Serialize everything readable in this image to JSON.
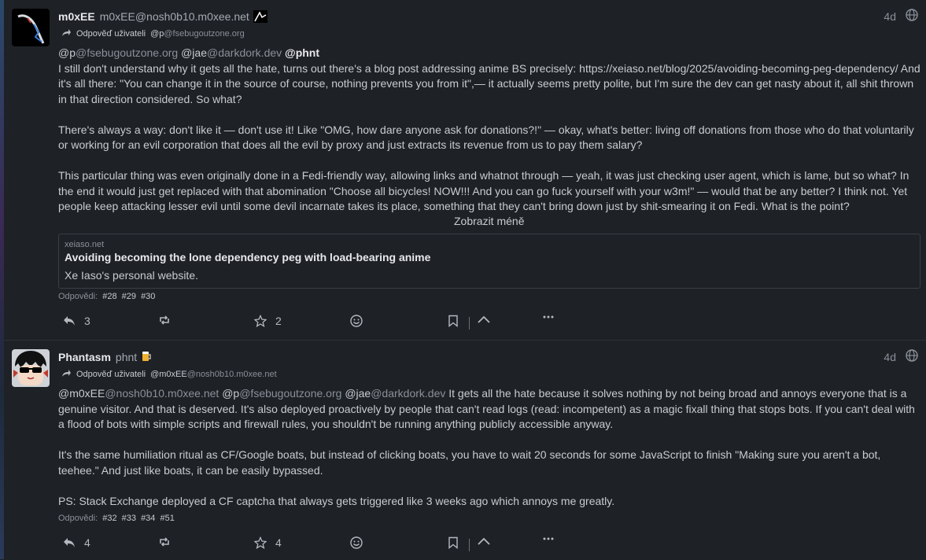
{
  "posts": [
    {
      "name": "m0xEE",
      "handle": "m0xEE@nosh0b10.m0xee.net",
      "time": "4d",
      "reply_label": "Odpověď uživateli",
      "reply_to_user": "@p",
      "reply_to_domain": "@fsebugoutzone.org",
      "mentions": [
        {
          "user": "@p",
          "domain": "@fsebugoutzone.org"
        },
        {
          "user": "@jae",
          "domain": "@darkdork.dev"
        }
      ],
      "mention_bold": "@phnt",
      "paragraphs": [
        "I still don't understand why it gets all the hate, turns out there's a blog post addressing anime BS precisely: https://xeiaso.net/blog/2025/avoiding-becoming-peg-dependency/ And it's all there: \"You can change it in the source of course, nothing prevents you from it\",— it actually seems pretty polite, but I'm sure the dev can get nasty about it, all shit thrown in that direction considered. So what?",
        "There's always a way: don't like it — don't use it! Like \"OMG, how dare anyone ask for donations?!\" — okay, what's better: living off donations from those who do that voluntarily or working for an evil corporation that does all the evil by proxy and just extracts its revenue from us to pay them salary?",
        "This particular thing was even originally done in a Fedi-friendly way, allowing links and whatnot through — yeah, it was just checking user agent, which is lame, but so what? In the end it would just get replaced with that abomination \"Choose all bicycles! NOW!!! And you can go fuck yourself with your w3m!\" — would that be any better? I think not. Yet people keep attacking lesser evil until some devil incarnate takes its place, something that they can't bring down just by shit-smearing it on Fedi. What is the point?"
      ],
      "show_less": "Zobrazit méně",
      "card": {
        "host": "xeiaso.net",
        "title": "Avoiding becoming the lone dependency peg with load-bearing anime",
        "description": "Xe Iaso's personal website."
      },
      "replies_label": "Odpovědi:",
      "replies": [
        "#28",
        "#29",
        "#30"
      ],
      "reply_count": "3",
      "fav_count": "2"
    },
    {
      "name": "Phantasm",
      "handle": "phnt",
      "time": "4d",
      "reply_label": "Odpověď uživateli",
      "reply_to_user": "@m0xEE",
      "reply_to_domain": "@nosh0b10.m0xee.net",
      "mentions": [
        {
          "user": "@m0xEE",
          "domain": "@nosh0b10.m0xee.net"
        },
        {
          "user": "@p",
          "domain": "@fsebugoutzone.org"
        },
        {
          "user": "@jae",
          "domain": "@darkdork.dev"
        }
      ],
      "first_text": " It gets all the hate because it solves nothing by not being broad and annoys everyone that is a genuine visitor. And that is deserved. It's also deployed proactively by people that can't read logs (read: incompetent) as a magic fixall thing that stops bots. If you can't deal with a flood of bots with simple scripts and firewall rules, you shouldn't be running anything publicly accessible anyway.",
      "paragraphs": [
        "It's the same humiliation ritual as CF/Google boats, but instead of clicking boats, you have to wait 20 seconds for some JavaScript to finish \"Making sure you aren't a bot, teehee.\" And just like boats, it can be easily bypassed.",
        "PS: Stack Exchange deployed a CF captcha that always gets triggered like 3 weeks ago which annoys me greatly."
      ],
      "replies_label": "Odpovědi:",
      "replies": [
        "#32",
        "#33",
        "#34",
        "#51"
      ],
      "reply_count": "4",
      "fav_count": "4"
    }
  ],
  "colors": {
    "background": "#1e2126",
    "text": "#c8ccd1",
    "muted": "#8a9099"
  },
  "icons": [
    "reply-icon",
    "repeat-icon",
    "star-icon",
    "emoji-react-icon",
    "bookmark-icon",
    "collapse-icon",
    "more-icon",
    "globe-icon"
  ]
}
